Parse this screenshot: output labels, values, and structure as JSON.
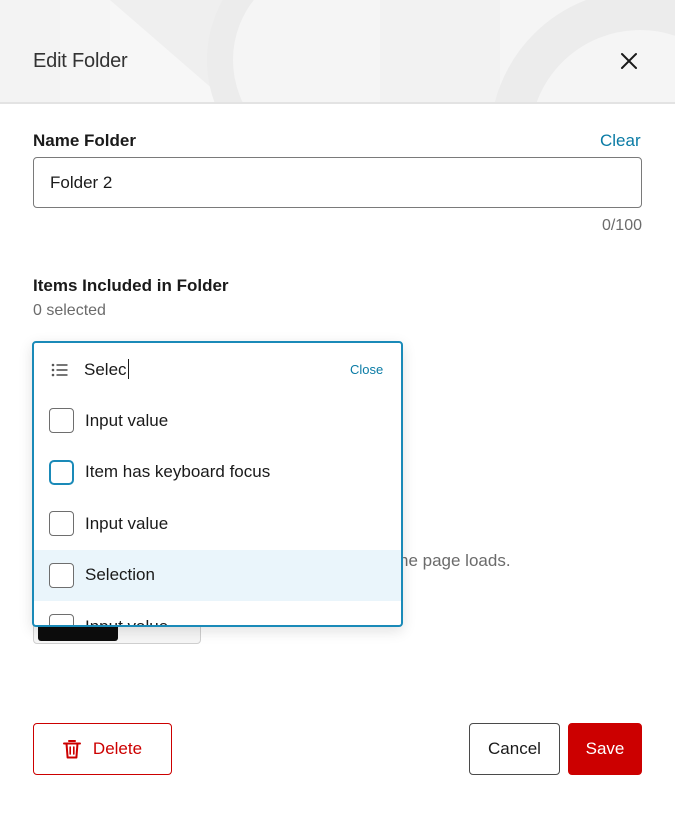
{
  "dialog": {
    "title": "Edit Folder"
  },
  "name_field": {
    "label": "Name Folder",
    "clear_label": "Clear",
    "value": "Folder 2",
    "char_count": "0/100"
  },
  "items_field": {
    "label": "Items Included in Folder",
    "selected_text": "0 selected"
  },
  "dropdown": {
    "search_value": "Selec",
    "close_label": "Close",
    "options": [
      {
        "label": "Input value",
        "state": "default"
      },
      {
        "label": "Item has keyboard focus",
        "state": "focus"
      },
      {
        "label": "Input value",
        "state": "default"
      },
      {
        "label": "Selection",
        "state": "hover"
      },
      {
        "label": "Input value",
        "state": "default"
      }
    ]
  },
  "background_content": {
    "partial_text": "he page loads."
  },
  "footer": {
    "delete_label": "Delete",
    "cancel_label": "Cancel",
    "save_label": "Save"
  },
  "colors": {
    "accent": "#1a8ab8",
    "link": "#0a7ba5",
    "danger": "#cc0000",
    "hover_row": "#eaf5fb"
  }
}
